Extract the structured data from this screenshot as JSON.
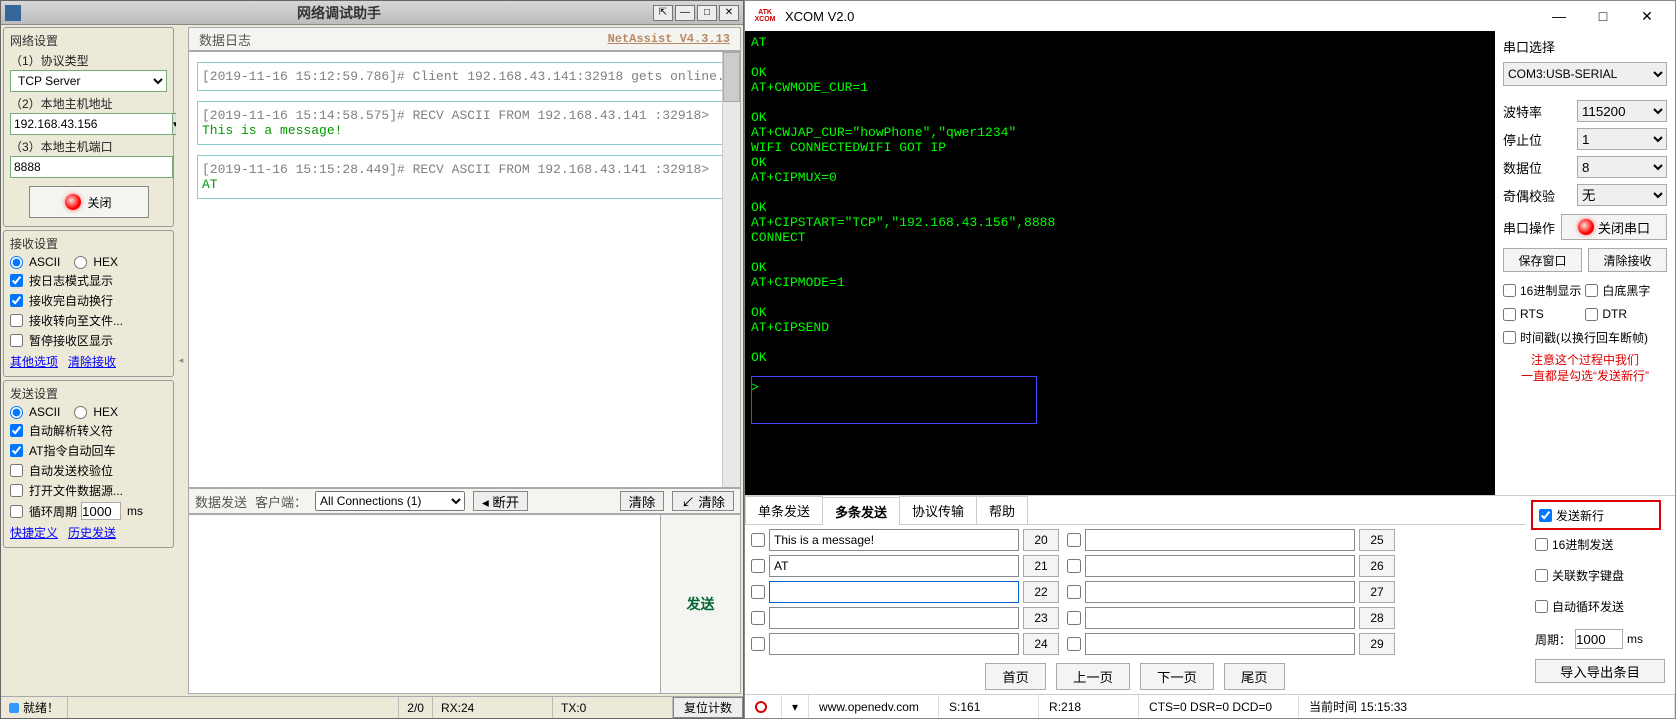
{
  "left": {
    "title": "网络调试助手",
    "version": "NetAssist V4.3.13",
    "net": {
      "legend": "网络设置",
      "proto_label": "（1）协议类型",
      "proto_value": "TCP Server",
      "host_label": "（2）本地主机地址",
      "host_value": "192.168.43.156",
      "port_label": "（3）本地主机端口",
      "port_value": "8888",
      "close_btn": "关闭"
    },
    "recv": {
      "legend": "接收设置",
      "ascii": "ASCII",
      "hex": "HEX",
      "logmode": "按日志模式显示",
      "autoline": "接收完自动换行",
      "tofile": "接收转向至文件...",
      "pause": "暂停接收区显示",
      "other": "其他选项",
      "clear": "清除接收"
    },
    "send": {
      "legend": "发送设置",
      "ascii": "ASCII",
      "hex": "HEX",
      "escape": "自动解析转义符",
      "atcr": "AT指令自动回车",
      "checksum": "自动发送校验位",
      "filesrc": "打开文件数据源...",
      "cycle_label": "循环周期",
      "cycle_value": "1000",
      "cycle_unit": "ms",
      "shortcut": "快捷定义",
      "history": "历史发送"
    },
    "log": {
      "tab": "数据日志",
      "e1_hdr": "[2019-11-16 15:12:59.786]# Client 192.168.43.141:32918 gets online.",
      "e2_hdr": "[2019-11-16 15:14:58.575]# RECV ASCII FROM 192.168.43.141 :32918>",
      "e2_msg": "This is a message!",
      "e3_hdr": "[2019-11-16 15:15:28.449]# RECV ASCII FROM 192.168.43.141 :32918>",
      "e3_msg": "AT"
    },
    "sendbar": {
      "tab_data": "数据发送",
      "tab_client": "客户端：",
      "conn_sel": "All Connections (1)",
      "disconnect": "◂ 断开",
      "clear": "清除",
      "clear2": "↙ 清除",
      "send_btn": "发送"
    },
    "status": {
      "ready": "就绪！",
      "counts": "2/0",
      "rx": "RX:24",
      "tx": "TX:0",
      "reset": "复位计数"
    }
  },
  "right": {
    "title": "XCOM V2.0",
    "logo1": "ATK",
    "logo2": "XCOM",
    "terminal": "AT\n\nOK\nAT+CWMODE_CUR=1\n\nOK\nAT+CWJAP_CUR=\"howPhone\",\"qwer1234\"\nWIFI CONNECTEDWIFI GOT IP\nOK\nAT+CIPMUX=0\n\nOK\nAT+CIPSTART=\"TCP\",\"192.168.43.156\",8888\nCONNECT\n\nOK\nAT+CIPMODE=1\n\nOK\nAT+CIPSEND\n\nOK\n\n>",
    "panel": {
      "title": "串口选择",
      "port": "COM3:USB-SERIAL",
      "baud_l": "波特率",
      "baud_v": "115200",
      "stop_l": "停止位",
      "stop_v": "1",
      "data_l": "数据位",
      "data_v": "8",
      "parity_l": "奇偶校验",
      "parity_v": "无",
      "op_l": "串口操作",
      "op_btn": "关闭串口",
      "save_win": "保存窗口",
      "clear_recv": "清除接收",
      "hex_disp": "16进制显示",
      "white_bg": "白底黑字",
      "rts": "RTS",
      "dtr": "DTR",
      "timestamp": "时间戳(以换行回车断帧)",
      "note1": "注意这个过程中我们",
      "note2": "一直都是勾选“发送新行”"
    },
    "tabs": {
      "single": "单条发送",
      "multi": "多条发送",
      "proto": "协议传输",
      "help": "帮助"
    },
    "ms": {
      "row0_text": "This is a message!",
      "row0_btn": "20",
      "row0b_btn": "25",
      "row1_text": "AT",
      "row1_btn": "21",
      "row1b_btn": "26",
      "row2_btn": "22",
      "row2b_btn": "27",
      "row3_btn": "23",
      "row3b_btn": "28",
      "row4_btn": "24",
      "row4b_btn": "29",
      "newline": "发送新行",
      "hex_send": "16进制发送",
      "numpad": "关联数字键盘",
      "autocycle": "自动循环发送",
      "cycle_l": "周期：",
      "cycle_v": "1000",
      "cycle_u": "ms",
      "export": "导入导出条目"
    },
    "pager": {
      "first": "首页",
      "prev": "上一页",
      "next": "下一页",
      "last": "尾页"
    },
    "status": {
      "url": "www.openedv.com",
      "s": "S:161",
      "r": "R:218",
      "sig": "CTS=0 DSR=0 DCD=0",
      "time": "当前时间 15:15:33"
    }
  }
}
